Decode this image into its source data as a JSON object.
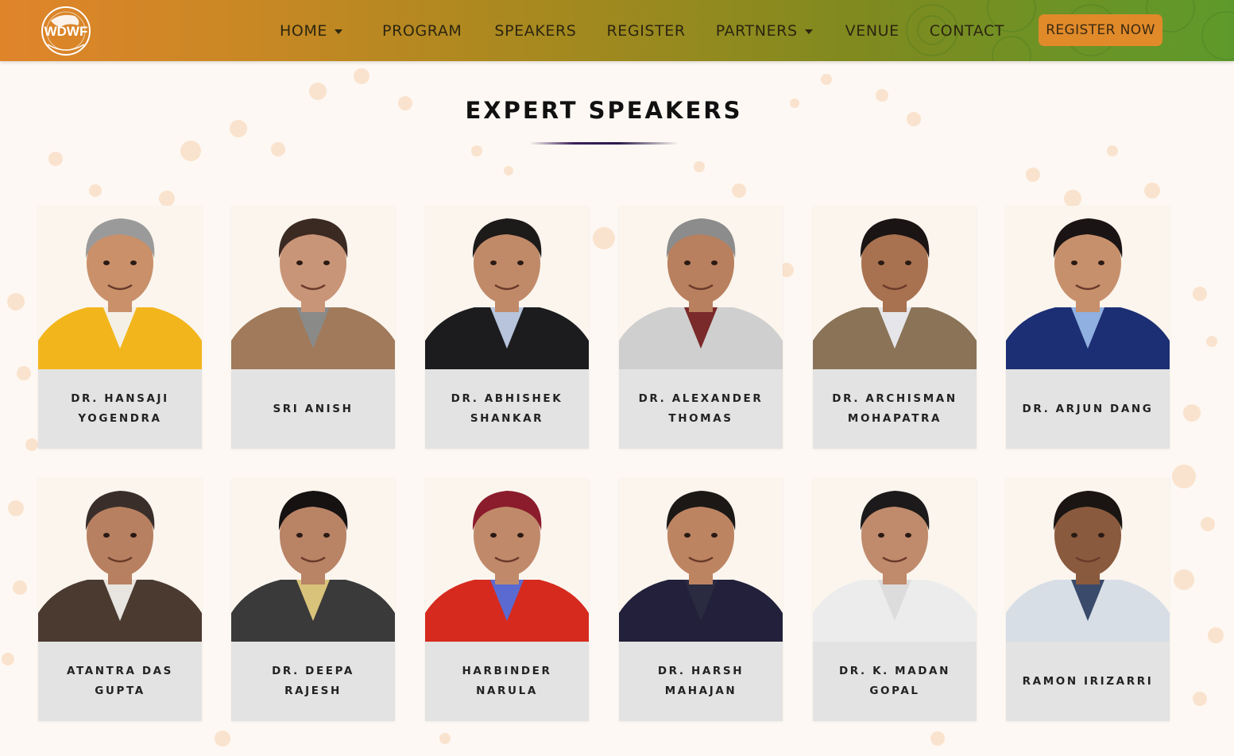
{
  "header": {
    "logo_text": "WDWF",
    "nav": [
      {
        "label": "HOME",
        "dropdown": true
      },
      {
        "label": "PROGRAM",
        "dropdown": false
      },
      {
        "label": "SPEAKERS",
        "dropdown": false
      },
      {
        "label": "REGISTER",
        "dropdown": false
      },
      {
        "label": "PARTNERS",
        "dropdown": true
      },
      {
        "label": "VENUE",
        "dropdown": false
      },
      {
        "label": "CONTACT",
        "dropdown": false
      }
    ],
    "cta_label": "REGISTER NOW"
  },
  "section": {
    "title": "EXPERT SPEAKERS"
  },
  "speakers": [
    {
      "name": "DR. HANSAJI YOGENDRA",
      "skin": "#c9906a",
      "hair": "#9a9a9a",
      "outfit": "#f2b51c",
      "accent": "#f4f0e6"
    },
    {
      "name": "SRI ANISH",
      "skin": "#c99578",
      "hair": "#3b2a22",
      "outfit": "#a07a5a",
      "accent": "#8a8a88"
    },
    {
      "name": "DR. ABHISHEK SHANKAR",
      "skin": "#c08a68",
      "hair": "#1d1a1a",
      "outfit": "#1c1c1f",
      "accent": "#b7c4dc"
    },
    {
      "name": "DR. ALEXANDER THOMAS",
      "skin": "#b8805e",
      "hair": "#8c8c8c",
      "outfit": "#cfcfcf",
      "accent": "#7a2a2a"
    },
    {
      "name": "DR. ARCHISMAN MOHAPATRA",
      "skin": "#a8714f",
      "hair": "#1a1414",
      "outfit": "#8a7357",
      "accent": "#e6e6ea"
    },
    {
      "name": "DR. ARJUN DANG",
      "skin": "#c7906c",
      "hair": "#1a1414",
      "outfit": "#1d2f74",
      "accent": "#8fb0e0"
    },
    {
      "name": "ATANTRA DAS GUPTA",
      "skin": "#b78060",
      "hair": "#3a2e2a",
      "outfit": "#4a3a30",
      "accent": "#e8e4e0"
    },
    {
      "name": "DR. DEEPA RAJESH",
      "skin": "#b98366",
      "hair": "#161212",
      "outfit": "#3a3a3a",
      "accent": "#d9c37a"
    },
    {
      "name": "HARBINDER NARULA",
      "skin": "#c08a6a",
      "hair": "#8b1c2c",
      "outfit": "#d62a1e",
      "accent": "#5a6ad0"
    },
    {
      "name": "DR. HARSH MAHAJAN",
      "skin": "#bd8462",
      "hair": "#1c1816",
      "outfit": "#22203a",
      "accent": "#2a2a40"
    },
    {
      "name": "DR. K. MADAN GOPAL",
      "skin": "#c08a6c",
      "hair": "#1c1a1a",
      "outfit": "#ececec",
      "accent": "#dcdcdc"
    },
    {
      "name": "RAMON IRIZARRI",
      "skin": "#8a5a3e",
      "hair": "#1a1512",
      "outfit": "#d8dee6",
      "accent": "#3a4a6a"
    }
  ]
}
